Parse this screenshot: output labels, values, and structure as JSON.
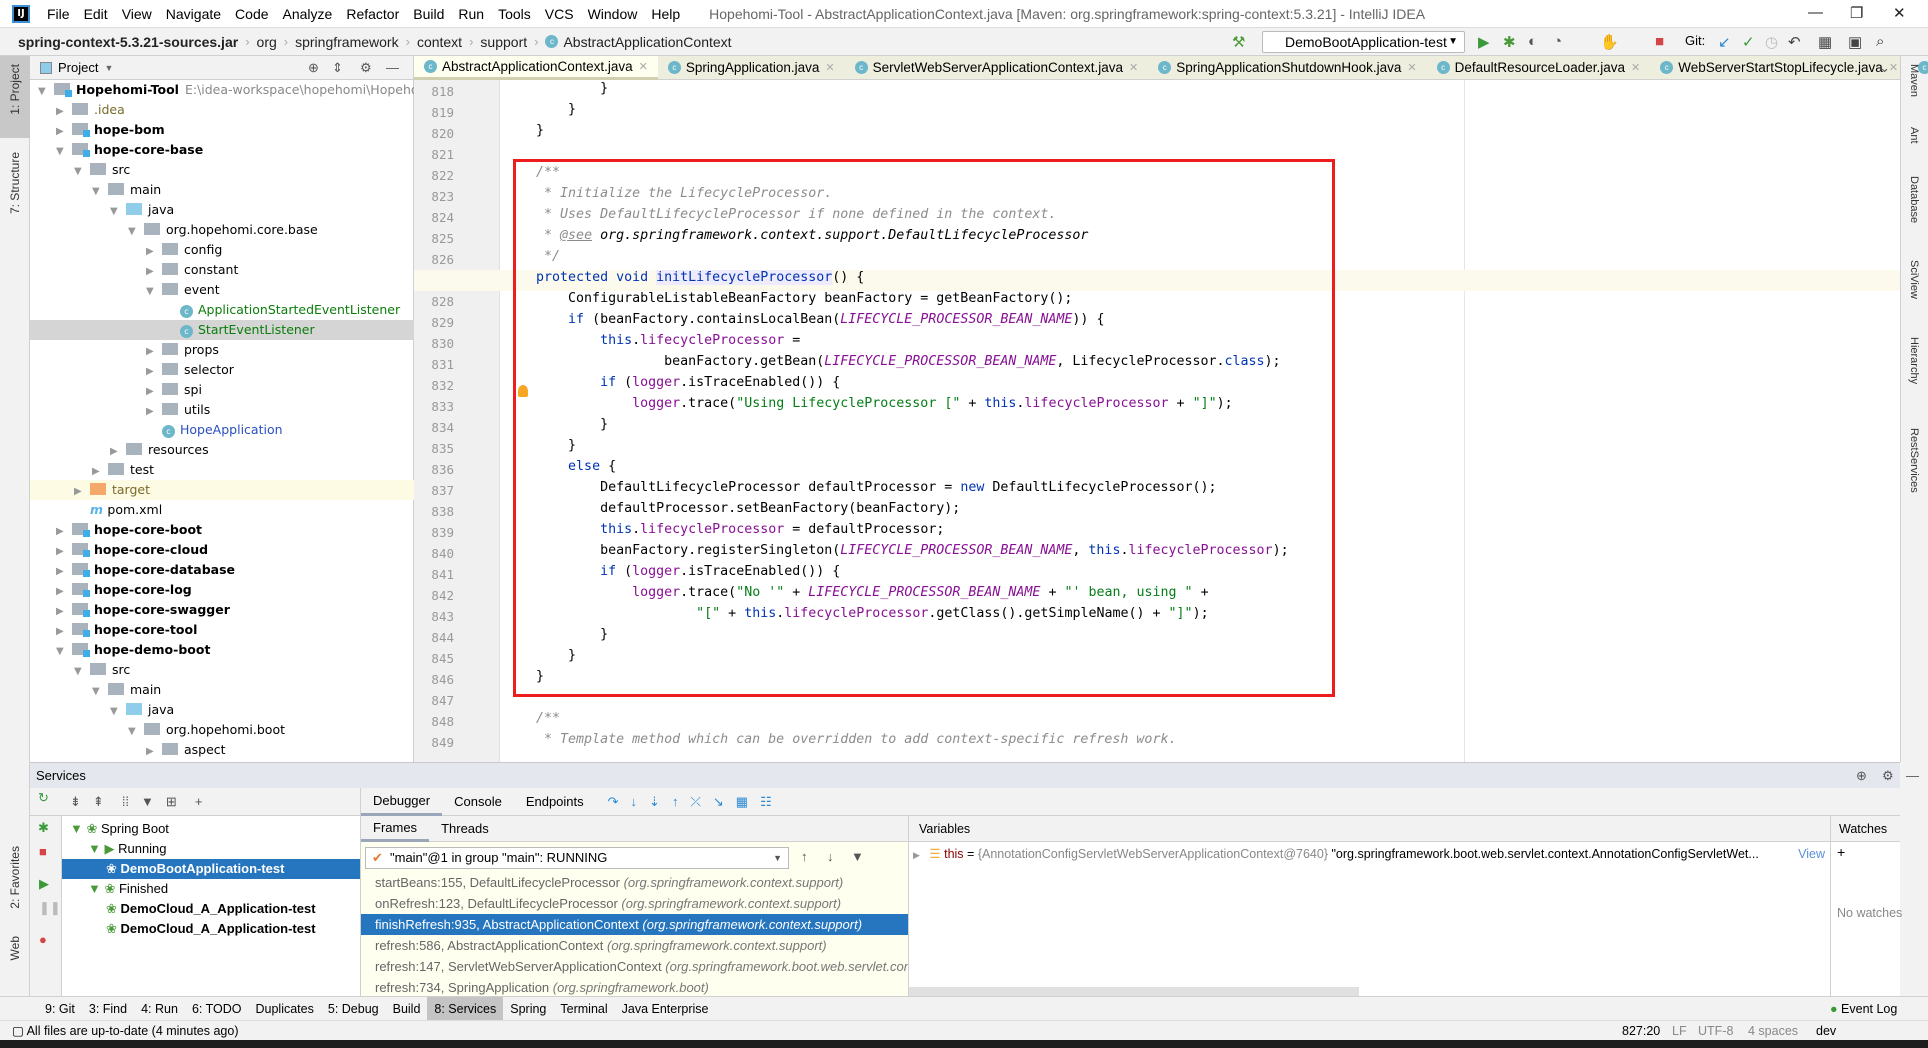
{
  "menubar": {
    "items": [
      "File",
      "Edit",
      "View",
      "Navigate",
      "Code",
      "Analyze",
      "Refactor",
      "Build",
      "Run",
      "Tools",
      "VCS",
      "Window",
      "Help"
    ],
    "title": "Hopehomi-Tool - AbstractApplicationContext.java [Maven: org.springframework:spring-context:5.3.21] - IntelliJ IDEA"
  },
  "navbar": {
    "crumbs": [
      "spring-context-5.3.21-sources.jar",
      "org",
      "springframework",
      "context",
      "support",
      "AbstractApplicationContext"
    ],
    "run_config": "DemoBootApplication-test",
    "git_label": "Git:"
  },
  "left_strip": {
    "project": "1: Project",
    "structure": "7: Structure",
    "favorites": "2: Favorites",
    "web": "Web"
  },
  "right_strip": [
    "Maven",
    "Ant",
    "Database",
    "SciView",
    "Hierarchy",
    "RestServices"
  ],
  "project": {
    "title": "Project",
    "items": [
      {
        "label": "Hopehomi-Tool",
        "path": "E:\\idea-workspace\\hopehomi\\Hopehomi-",
        "depth": 0,
        "open": true,
        "type": "mod",
        "bold": true
      },
      {
        "label": ".idea",
        "depth": 1,
        "open": false,
        "type": "dir",
        "color": "#7a6a2a"
      },
      {
        "label": "hope-bom",
        "depth": 1,
        "open": false,
        "type": "mod",
        "bold": true
      },
      {
        "label": "hope-core-base",
        "depth": 1,
        "open": true,
        "type": "mod",
        "bold": true
      },
      {
        "label": "src",
        "depth": 2,
        "open": true,
        "type": "dir"
      },
      {
        "label": "main",
        "depth": 3,
        "open": true,
        "type": "dir"
      },
      {
        "label": "java",
        "depth": 4,
        "open": true,
        "type": "src"
      },
      {
        "label": "org.hopehomi.core.base",
        "depth": 5,
        "open": true,
        "type": "pkg"
      },
      {
        "label": "config",
        "depth": 6,
        "open": false,
        "type": "pkg"
      },
      {
        "label": "constant",
        "depth": 6,
        "open": false,
        "type": "pkg"
      },
      {
        "label": "event",
        "depth": 6,
        "open": true,
        "type": "pkg"
      },
      {
        "label": "ApplicationStartedEventListener",
        "depth": 7,
        "type": "class",
        "color": "#0a7d0a"
      },
      {
        "label": "StartEventListener",
        "depth": 7,
        "type": "class",
        "color": "#0a7d0a",
        "selected": true
      },
      {
        "label": "props",
        "depth": 6,
        "open": false,
        "type": "pkg"
      },
      {
        "label": "selector",
        "depth": 6,
        "open": false,
        "type": "pkg"
      },
      {
        "label": "spi",
        "depth": 6,
        "open": false,
        "type": "pkg"
      },
      {
        "label": "utils",
        "depth": 6,
        "open": false,
        "type": "pkg"
      },
      {
        "label": "HopeApplication",
        "depth": 6,
        "type": "class",
        "color": "#2a4fc0"
      },
      {
        "label": "resources",
        "depth": 4,
        "open": false,
        "type": "dir"
      },
      {
        "label": "test",
        "depth": 3,
        "open": false,
        "type": "dir"
      },
      {
        "label": "target",
        "depth": 2,
        "open": false,
        "type": "tgt",
        "color": "#7a6a2a",
        "highlight": true
      },
      {
        "label": "pom.xml",
        "depth": 2,
        "type": "pom"
      },
      {
        "label": "hope-core-boot",
        "depth": 1,
        "open": false,
        "type": "mod",
        "bold": true
      },
      {
        "label": "hope-core-cloud",
        "depth": 1,
        "open": false,
        "type": "mod",
        "bold": true
      },
      {
        "label": "hope-core-database",
        "depth": 1,
        "open": false,
        "type": "mod",
        "bold": true
      },
      {
        "label": "hope-core-log",
        "depth": 1,
        "open": false,
        "type": "mod",
        "bold": true
      },
      {
        "label": "hope-core-swagger",
        "depth": 1,
        "open": false,
        "type": "mod",
        "bold": true
      },
      {
        "label": "hope-core-tool",
        "depth": 1,
        "open": false,
        "type": "mod",
        "bold": true
      },
      {
        "label": "hope-demo-boot",
        "depth": 1,
        "open": true,
        "type": "mod",
        "bold": true
      },
      {
        "label": "src",
        "depth": 2,
        "open": true,
        "type": "dir"
      },
      {
        "label": "main",
        "depth": 3,
        "open": true,
        "type": "dir"
      },
      {
        "label": "java",
        "depth": 4,
        "open": true,
        "type": "src"
      },
      {
        "label": "org.hopehomi.boot",
        "depth": 5,
        "open": true,
        "type": "pkg"
      },
      {
        "label": "aspect",
        "depth": 6,
        "open": false,
        "type": "pkg"
      }
    ]
  },
  "tabs": [
    {
      "label": "AbstractApplicationContext.java",
      "active": true
    },
    {
      "label": "SpringApplication.java"
    },
    {
      "label": "ServletWebServerApplicationContext.java"
    },
    {
      "label": "SpringApplicationShutdownHook.java"
    },
    {
      "label": "DefaultResourceLoader.java"
    },
    {
      "label": "WebServerStartStopLifecycle.java"
    },
    {
      "label": "De"
    }
  ],
  "editor": {
    "current_line": 827,
    "lines": [
      {
        "n": 818,
        "t": [
          [
            "p",
            "            }"
          ]
        ]
      },
      {
        "n": 819,
        "t": [
          [
            "p",
            "        }"
          ]
        ]
      },
      {
        "n": 820,
        "t": [
          [
            "p",
            "    }"
          ]
        ]
      },
      {
        "n": 821,
        "t": []
      },
      {
        "n": 822,
        "t": [
          [
            "c",
            "    /**"
          ]
        ]
      },
      {
        "n": 823,
        "t": [
          [
            "c",
            "     * Initialize the LifecycleProcessor."
          ]
        ]
      },
      {
        "n": 824,
        "t": [
          [
            "c",
            "     * Uses DefaultLifecycleProcessor if none defined in the context."
          ]
        ]
      },
      {
        "n": 825,
        "t": [
          [
            "c",
            "     * "
          ],
          [
            "tag",
            "@see"
          ],
          [
            "ref",
            " org.springframework.context.support.DefaultLifecycleProcessor"
          ]
        ]
      },
      {
        "n": 826,
        "t": [
          [
            "c",
            "     */"
          ]
        ]
      },
      {
        "n": 827,
        "t": [
          [
            "p",
            "    "
          ],
          [
            "k",
            "protected void "
          ],
          [
            "hl",
            "initLifecycleProcessor"
          ],
          [
            "p",
            "() {"
          ]
        ]
      },
      {
        "n": 828,
        "t": [
          [
            "p",
            "        ConfigurableListableBeanFactory beanFactory = getBeanFactory();"
          ]
        ]
      },
      {
        "n": 829,
        "t": [
          [
            "p",
            "        "
          ],
          [
            "k",
            "if"
          ],
          [
            "p",
            " (beanFactory.containsLocalBean("
          ],
          [
            "cst",
            "LIFECYCLE_PROCESSOR_BEAN_NAME"
          ],
          [
            "p",
            ")) {"
          ]
        ]
      },
      {
        "n": 830,
        "t": [
          [
            "p",
            "            "
          ],
          [
            "k",
            "this"
          ],
          [
            "p",
            "."
          ],
          [
            "f",
            "lifecycleProcessor"
          ],
          [
            "p",
            " ="
          ]
        ]
      },
      {
        "n": 831,
        "t": [
          [
            "p",
            "                    beanFactory.getBean("
          ],
          [
            "cst",
            "LIFECYCLE_PROCESSOR_BEAN_NAME"
          ],
          [
            "p",
            ", LifecycleProcessor."
          ],
          [
            "k",
            "class"
          ],
          [
            "p",
            ");"
          ]
        ]
      },
      {
        "n": 832,
        "t": [
          [
            "p",
            "            "
          ],
          [
            "k",
            "if"
          ],
          [
            "p",
            " ("
          ],
          [
            "f",
            "logger"
          ],
          [
            "p",
            ".isTraceEnabled()) {"
          ]
        ]
      },
      {
        "n": 833,
        "t": [
          [
            "p",
            "                "
          ],
          [
            "f",
            "logger"
          ],
          [
            "p",
            ".trace("
          ],
          [
            "s",
            "\"Using LifecycleProcessor [\""
          ],
          [
            "p",
            " + "
          ],
          [
            "k",
            "this"
          ],
          [
            "p",
            "."
          ],
          [
            "f",
            "lifecycleProcessor"
          ],
          [
            "p",
            " + "
          ],
          [
            "s",
            "\"]\""
          ],
          [
            "p",
            ");"
          ]
        ]
      },
      {
        "n": 834,
        "t": [
          [
            "p",
            "            }"
          ]
        ]
      },
      {
        "n": 835,
        "t": [
          [
            "p",
            "        }"
          ]
        ]
      },
      {
        "n": 836,
        "t": [
          [
            "p",
            "        "
          ],
          [
            "k",
            "else"
          ],
          [
            "p",
            " {"
          ]
        ]
      },
      {
        "n": 837,
        "t": [
          [
            "p",
            "            DefaultLifecycleProcessor defaultProcessor = "
          ],
          [
            "k",
            "new"
          ],
          [
            "p",
            " DefaultLifecycleProcessor();"
          ]
        ]
      },
      {
        "n": 838,
        "t": [
          [
            "p",
            "            defaultProcessor.setBeanFactory(beanFactory);"
          ]
        ]
      },
      {
        "n": 839,
        "t": [
          [
            "p",
            "            "
          ],
          [
            "k",
            "this"
          ],
          [
            "p",
            "."
          ],
          [
            "f",
            "lifecycleProcessor"
          ],
          [
            "p",
            " = defaultProcessor;"
          ]
        ]
      },
      {
        "n": 840,
        "t": [
          [
            "p",
            "            beanFactory.registerSingleton("
          ],
          [
            "cst",
            "LIFECYCLE_PROCESSOR_BEAN_NAME"
          ],
          [
            "p",
            ", "
          ],
          [
            "k",
            "this"
          ],
          [
            "p",
            "."
          ],
          [
            "f",
            "lifecycleProcessor"
          ],
          [
            "p",
            ");"
          ]
        ]
      },
      {
        "n": 841,
        "t": [
          [
            "p",
            "            "
          ],
          [
            "k",
            "if"
          ],
          [
            "p",
            " ("
          ],
          [
            "f",
            "logger"
          ],
          [
            "p",
            ".isTraceEnabled()) {"
          ]
        ]
      },
      {
        "n": 842,
        "t": [
          [
            "p",
            "                "
          ],
          [
            "f",
            "logger"
          ],
          [
            "p",
            ".trace("
          ],
          [
            "s",
            "\"No '\""
          ],
          [
            "p",
            " + "
          ],
          [
            "cst",
            "LIFECYCLE_PROCESSOR_BEAN_NAME"
          ],
          [
            "p",
            " + "
          ],
          [
            "s",
            "\"' bean, using \""
          ],
          [
            "p",
            " +"
          ]
        ]
      },
      {
        "n": 843,
        "t": [
          [
            "p",
            "                        "
          ],
          [
            "s",
            "\"[\""
          ],
          [
            "p",
            " + "
          ],
          [
            "k",
            "this"
          ],
          [
            "p",
            "."
          ],
          [
            "f",
            "lifecycleProcessor"
          ],
          [
            "p",
            ".getClass().getSimpleName() + "
          ],
          [
            "s",
            "\"]\""
          ],
          [
            "p",
            ");"
          ]
        ]
      },
      {
        "n": 844,
        "t": [
          [
            "p",
            "            }"
          ]
        ]
      },
      {
        "n": 845,
        "t": [
          [
            "p",
            "        }"
          ]
        ]
      },
      {
        "n": 846,
        "t": [
          [
            "p",
            "    }"
          ]
        ]
      },
      {
        "n": 847,
        "t": []
      },
      {
        "n": 848,
        "t": [
          [
            "c",
            "    /**"
          ]
        ]
      },
      {
        "n": 849,
        "t": [
          [
            "c",
            "     * Template method which can be overridden to add context-specific refresh work."
          ]
        ]
      }
    ],
    "annotation_color": "#ee1c1c"
  },
  "services": {
    "title": "Services",
    "tree": [
      {
        "label": "Spring Boot",
        "depth": 0
      },
      {
        "label": "Running",
        "depth": 1
      },
      {
        "label": "DemoBootApplication-test",
        "depth": 2,
        "bold": true,
        "selected": true
      },
      {
        "label": "Finished",
        "depth": 1
      },
      {
        "label": "DemoCloud_A_Application-test",
        "depth": 2,
        "bold": true
      },
      {
        "label": "DemoCloud_A_Application-test",
        "depth": 2,
        "bold": true
      }
    ],
    "debug_tabs": [
      "Debugger",
      "Console",
      "Endpoints"
    ],
    "frame_tabs": [
      "Frames",
      "Threads"
    ],
    "thread": "\"main\"@1 in group \"main\": RUNNING",
    "frames": [
      {
        "m": "startBeans:155, DefaultLifecycleProcessor",
        "p": "(org.springframework.context.support)"
      },
      {
        "m": "onRefresh:123, DefaultLifecycleProcessor",
        "p": "(org.springframework.context.support)"
      },
      {
        "m": "finishRefresh:935, AbstractApplicationContext",
        "p": "(org.springframework.context.support)",
        "selected": true
      },
      {
        "m": "refresh:586, AbstractApplicationContext",
        "p": "(org.springframework.context.support)"
      },
      {
        "m": "refresh:147, ServletWebServerApplicationContext",
        "p": "(org.springframework.boot.web.servlet.context)"
      },
      {
        "m": "refresh:734, SpringApplication",
        "p": "(org.springframework.boot)"
      }
    ],
    "variables_title": "Variables",
    "variable": {
      "name": "this",
      "eq": " = ",
      "type": "{AnnotationConfigServletWebServerApplicationContext@7640}",
      "value": " \"org.springframework.boot.web.servlet.context.AnnotationConfigServletWet...",
      "link": "View"
    },
    "watches_title": "Watches",
    "no_watches": "No watches"
  },
  "bottom_tabs": [
    {
      "label": "9: Git"
    },
    {
      "label": "3: Find"
    },
    {
      "label": "4: Run"
    },
    {
      "label": "6: TODO"
    },
    {
      "label": "Duplicates"
    },
    {
      "label": "5: Debug"
    },
    {
      "label": "Build"
    },
    {
      "label": "8: Services",
      "active": true
    },
    {
      "label": "Spring"
    },
    {
      "label": "Terminal"
    },
    {
      "label": "Java Enterprise"
    }
  ],
  "event_log": "Event Log",
  "status": {
    "message": "All files are up-to-date (4 minutes ago)",
    "position": "827:20",
    "line_sep": "LF",
    "encoding": "UTF-8",
    "indent": "4 spaces",
    "branch": "dev"
  }
}
